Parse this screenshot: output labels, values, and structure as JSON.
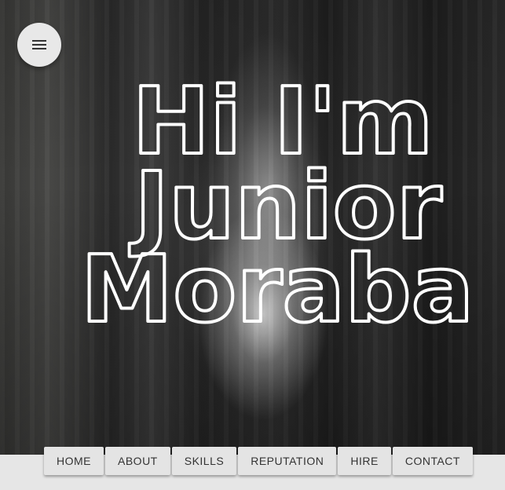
{
  "menu": {
    "icon": "menu-icon"
  },
  "headline": {
    "line1": "Hi I'm",
    "line2": "Junior",
    "line3": "Moraba"
  },
  "nav": {
    "items": [
      {
        "label": "HOME"
      },
      {
        "label": "ABOUT"
      },
      {
        "label": "SKILLS"
      },
      {
        "label": "REPUTATION"
      },
      {
        "label": "HIRE"
      },
      {
        "label": "CONTACT"
      }
    ]
  },
  "colors": {
    "headline_stroke": "#ffffff",
    "nav_button_bg": "#e4e4e4",
    "nav_text": "#333333",
    "fab_bg": "#e8e8e8"
  }
}
